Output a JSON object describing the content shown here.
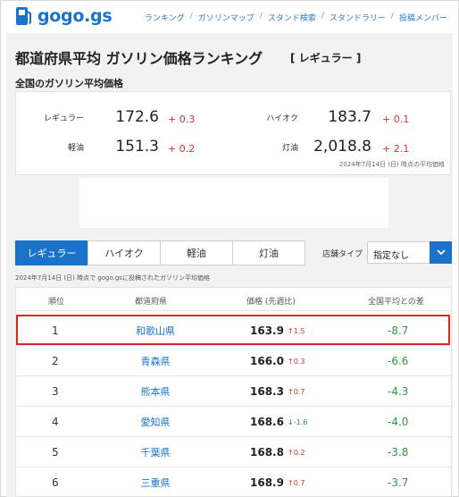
{
  "header": {
    "logo_text": "gogo.gs",
    "nav": [
      "ランキング",
      "ガソリンマップ",
      "スタンド検索",
      "スタンドラリー",
      "投稿メンバー"
    ]
  },
  "page": {
    "title": "都道府県平均 ガソリン価格ランキング",
    "tag": "[ レギュラー ]",
    "section_title": "全国のガソリン平均価格"
  },
  "national": {
    "items": [
      {
        "label": "レギュラー",
        "value": "172.6",
        "diff": "+ 0.3"
      },
      {
        "label": "ハイオク",
        "value": "183.7",
        "diff": "+ 0.1"
      },
      {
        "label": "軽油",
        "value": "151.3",
        "diff": "+ 0.2"
      },
      {
        "label": "灯油",
        "value": "2,018.8",
        "diff": "+ 2.1"
      }
    ],
    "asof": "2024年7月14日 (日) 時点の平均価格"
  },
  "tabs": [
    "レギュラー",
    "ハイオク",
    "軽油",
    "灯油"
  ],
  "filter": {
    "label": "店舗タイプ",
    "value": "指定なし"
  },
  "table": {
    "asof": "2024年7月14日 (日) 時点で gogo.gsに投稿されたガソリン平均価格",
    "headers": [
      "順位",
      "都道府県",
      "価格 (先週比)",
      "全国平均との差"
    ],
    "rows": [
      {
        "rank": "1",
        "pref": "和歌山県",
        "price": "163.9",
        "chg": "↑1.5",
        "dir": "up",
        "diff": "-8.7"
      },
      {
        "rank": "2",
        "pref": "青森県",
        "price": "166.0",
        "chg": "↑0.3",
        "dir": "up",
        "diff": "-6.6"
      },
      {
        "rank": "3",
        "pref": "熊本県",
        "price": "168.3",
        "chg": "↑0.7",
        "dir": "up",
        "diff": "-4.3"
      },
      {
        "rank": "4",
        "pref": "愛知県",
        "price": "168.6",
        "chg": "↓-1.6",
        "dir": "down",
        "diff": "-4.0"
      },
      {
        "rank": "5",
        "pref": "千葉県",
        "price": "168.8",
        "chg": "↑0.2",
        "dir": "up",
        "diff": "-3.8"
      },
      {
        "rank": "6",
        "pref": "三重県",
        "price": "168.9",
        "chg": "↑0.7",
        "dir": "up",
        "diff": "-3.7"
      }
    ]
  },
  "colors": {
    "accent": "#1a73c8",
    "up": "#d8342c",
    "down": "#2a8a3e",
    "highlight": "#e12222"
  }
}
